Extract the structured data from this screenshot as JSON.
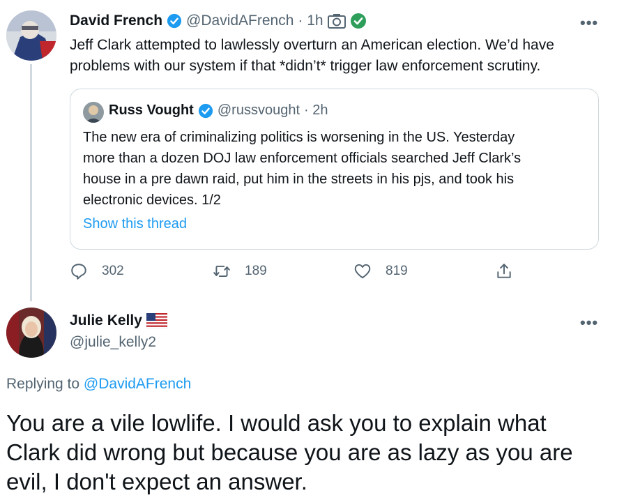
{
  "tweet": {
    "author_name": "David French",
    "handle": "@DavidAFrench",
    "time": "· 1h",
    "text_line1": "Jeff Clark attempted to lawlessly overturn an American election. We’d have",
    "text_line2": "problems with our system if that *didn’t* trigger law enforcement scrutiny.",
    "more": "•••",
    "quote": {
      "author_name": "Russ Vought",
      "handle": "@russvought",
      "time": "· 2h",
      "lines": [
        "The new era of criminalizing politics is worsening in the US. Yesterday",
        "more than a dozen DOJ law enforcement officials searched Jeff Clark’s",
        "house in a pre dawn raid, put him in the streets in his pjs, and took his",
        "electronic devices. 1/2"
      ],
      "show_thread": "Show this thread"
    },
    "actions": {
      "replies": "302",
      "retweets": "189",
      "likes": "819"
    }
  },
  "reply": {
    "author_name": "Julie Kelly",
    "handle": "@julie_kelly2",
    "more": "•••",
    "replying_prefix": "Replying to",
    "replying_to": "@DavidAFrench",
    "text_line1": "You are a vile lowlife. I would ask you to explain what",
    "text_line2": "Clark did wrong but because you are as lazy as you are",
    "text_line3": "evil, I don't expect an answer."
  },
  "colors": {
    "accent": "#1d9bf0",
    "muted": "#536471",
    "border": "#cfd9de",
    "verified": "#1d9bf0",
    "emoji_badge": "#2e9e5b"
  }
}
